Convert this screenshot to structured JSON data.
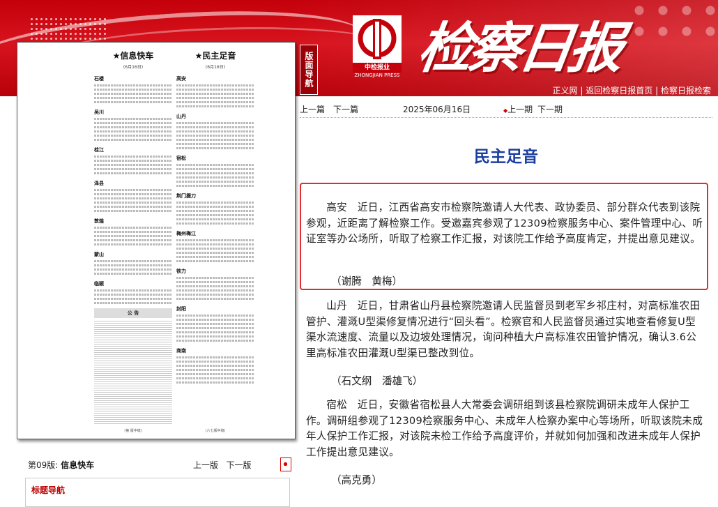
{
  "header": {
    "paper_title": "检察日报",
    "logo_small": "中检报业",
    "logo_press": "ZHONGJIAN PRESS",
    "links": [
      "正义网",
      "返回检察日报首页",
      "检察日报检索"
    ],
    "section_tab": "版面导航"
  },
  "left_page": {
    "col1_title": "★信息快车",
    "col1_date": "(6月16日)",
    "col1_items": [
      "石楼",
      "吴川",
      "桂江",
      "泽县",
      "敦煌",
      "蒙山",
      "临颍"
    ],
    "col1_notice": "公 告",
    "col1_foot": "(第 版中缝)",
    "col2_title": "★民主足音",
    "col2_date": "(6月16日)",
    "col2_items": [
      "高安",
      "山丹",
      "宿松",
      "荆门掇刀",
      "梅州梅江",
      "铁力",
      "封阳",
      "商南"
    ],
    "col2_foot": "(六七版中缝)",
    "edition_label": "第09版:",
    "edition_name": "信息快车",
    "prev_edition": "上一版",
    "next_edition": "下一版",
    "headline_nav": "标题导航"
  },
  "article_nav": {
    "prev_article": "上一篇",
    "next_article": "下一篇",
    "date": "2025年06月16日",
    "prev_issue": "上一期",
    "next_issue": "下一期"
  },
  "article": {
    "title": "民主足音",
    "paragraphs": [
      {
        "text": "高安　近日，江西省高安市检察院邀请人大代表、政协委员、部分群众代表到该院参观，近距离了解检察工作。受邀嘉宾参观了12309检察服务中心、案件管理中心、听证室等办公场所，听取了检察工作汇报，对该院工作给予高度肯定，并提出意见建议。",
        "author": "（谢腾　黄梅）"
      },
      {
        "text": "山丹　近日，甘肃省山丹县检察院邀请人民监督员到老军乡祁庄村，对高标准农田管护、灌溉U型渠修复情况进行“回头看”。检察官和人民监督员通过实地查看修复U型渠水流速度、流量以及边坡处理情况，询问种植大户高标准农田管护情况，确认3.6公里高标准农田灌溉U型渠已整改到位。",
        "author": "（石文纲　潘雄飞）"
      },
      {
        "text": "宿松　近日，安徽省宿松县人大常委会调研组到该县检察院调研未成年人保护工作。调研组参观了12309检察服务中心、未成年人检察办案中心等场所，听取该院未成年人保护工作汇报，对该院未检工作给予高度评价，并就如何加强和改进未成年人保护工作提出意见建议。",
        "author": "（高克勇）"
      }
    ]
  }
}
